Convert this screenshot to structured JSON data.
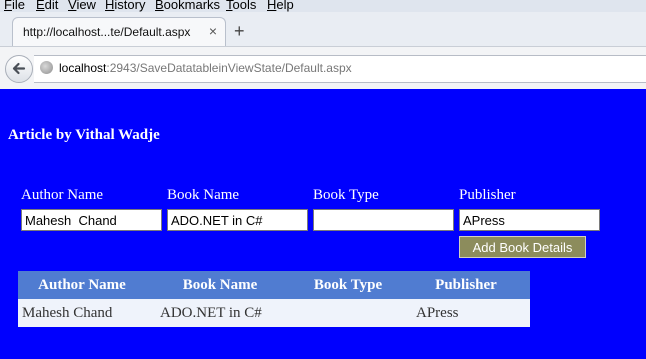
{
  "browser": {
    "menu": [
      "File",
      "Edit",
      "View",
      "History",
      "Bookmarks",
      "Tools",
      "Help"
    ],
    "tab_title": "http://localhost...te/Default.aspx",
    "tab_close": "×",
    "new_tab": "+",
    "url_host": "localhost",
    "url_rest": ":2943/SaveDatatableinViewState/Default.aspx"
  },
  "page": {
    "title": "Article by Vithal Wadje",
    "form": {
      "labels": [
        "Author Name",
        "Book Name",
        "Book Type",
        "Publisher"
      ],
      "values": [
        "Mahesh  Chand",
        "ADO.NET in C#",
        "",
        "APress"
      ],
      "submit_label": "Add Book Details"
    },
    "grid": {
      "headers": [
        "Author Name",
        "Book Name",
        "Book Type",
        "Publisher"
      ],
      "rows": [
        [
          "Mahesh Chand",
          "ADO.NET in C#",
          "",
          "APress"
        ]
      ]
    }
  },
  "colors": {
    "page_background": "#0000fe",
    "grid_header": "#507cd1",
    "grid_row": "#eff3fb",
    "button": "#8c8c5c"
  }
}
